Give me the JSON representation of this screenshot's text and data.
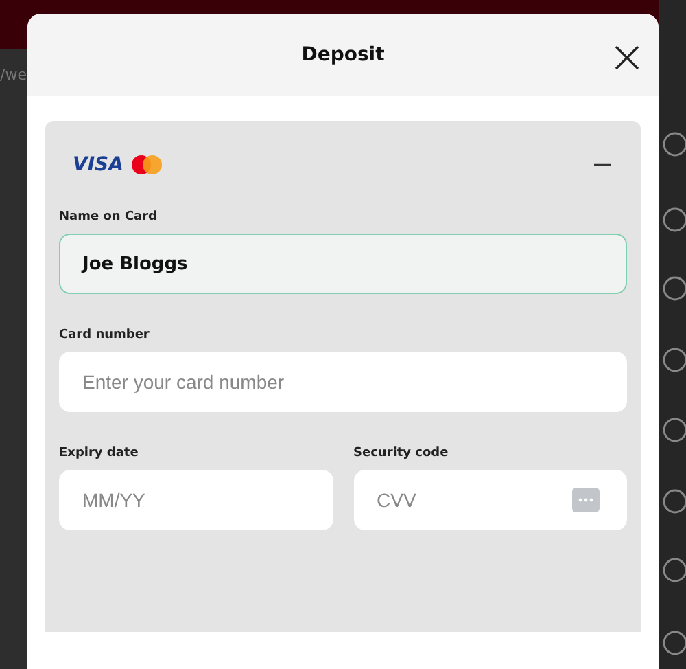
{
  "backdrop": {
    "url_fragment": "/we"
  },
  "dialog": {
    "title": "Deposit"
  },
  "payment_method": {
    "brand": "VISA",
    "expanded": true
  },
  "field_rows": [
    [
      {
        "label": "Name on Card",
        "value": "Joe Bloggs",
        "focused": true
      }
    ],
    [
      {
        "label": "Card number",
        "placeholder": "Enter your card number",
        "focused": false
      }
    ],
    [
      {
        "label": "Expiry date",
        "placeholder": "MM/YY",
        "focused": false
      },
      {
        "label": "Security code",
        "placeholder": "CVV",
        "focused": false,
        "kind": "cvv"
      }
    ]
  ]
}
